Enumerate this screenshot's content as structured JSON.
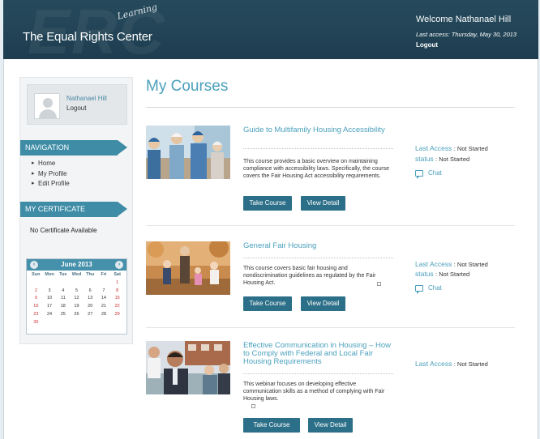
{
  "header": {
    "brand": "The Equal Rights Center",
    "brand_script": "Learning",
    "watermark": "ERC",
    "welcome": "Welcome Nathanael Hill",
    "last_access": "Last access: Thursday, May 30, 2013",
    "logout": "Logout"
  },
  "sidebar": {
    "user": {
      "name": "Nathanael Hill",
      "logout": "Logout"
    },
    "navigation_heading": "NAVIGATION",
    "nav_items": [
      "Home",
      "My Profile",
      "Edit Profile"
    ],
    "certificate_heading": "MY CERTIFICATE",
    "certificate_text": "No Certificate Available"
  },
  "calendar": {
    "month": "June 2013",
    "weekdays": [
      "Sun",
      "Mon",
      "Tue",
      "Wed",
      "Thu",
      "Fri",
      "Sat"
    ],
    "weeks": [
      [
        "",
        "",
        "",
        "",
        "",
        "",
        "1"
      ],
      [
        "2",
        "3",
        "4",
        "5",
        "6",
        "7",
        "8"
      ],
      [
        "9",
        "10",
        "11",
        "12",
        "13",
        "14",
        "15"
      ],
      [
        "16",
        "17",
        "18",
        "19",
        "20",
        "21",
        "22"
      ],
      [
        "23",
        "24",
        "25",
        "26",
        "27",
        "28",
        "29"
      ],
      [
        "30",
        "",
        "",
        "",
        "",
        "",
        ""
      ]
    ]
  },
  "main": {
    "title": "My Courses",
    "courses": [
      {
        "title": "Guide to Multifamily Housing Accessibility",
        "description": "This course provides a basic overview on maintaining compliance with accessibility laws. Specifically, the course covers the Fair Housing Act accessibility requirements.",
        "take_label": "Take Course",
        "detail_label": "View Detail",
        "last_access_label": "Last Access",
        "last_access_value": ": Not Started",
        "status_label": "status",
        "status_value": ": Not Started",
        "chat_label": "Chat"
      },
      {
        "title": "General Fair Housing",
        "description": "This course covers basic fair housing and nondiscrimination guidelines as regulated by the Fair Housing Act.",
        "take_label": "Take Course",
        "detail_label": "View Detail",
        "last_access_label": "Last Access",
        "last_access_value": ": Not Started",
        "status_label": "status",
        "status_value": ": Not Started",
        "chat_label": "Chat"
      },
      {
        "title": "Effective Communication in Housing – How to Comply with Federal and Local Fair Housing Requirements",
        "description": "This webinar focuses on developing effective communication skills as a method of complying with Fair Housing laws.",
        "take_label": "Take Course",
        "detail_label": "View Detail",
        "last_access_label": "Last Access",
        "last_access_value": ": Not Started"
      }
    ]
  },
  "colors": {
    "header_bg": "#264a5c",
    "accent": "#4aa0bc",
    "band": "#3e8ca6",
    "button": "#2c6f88",
    "weekend": "#c62e2e"
  }
}
